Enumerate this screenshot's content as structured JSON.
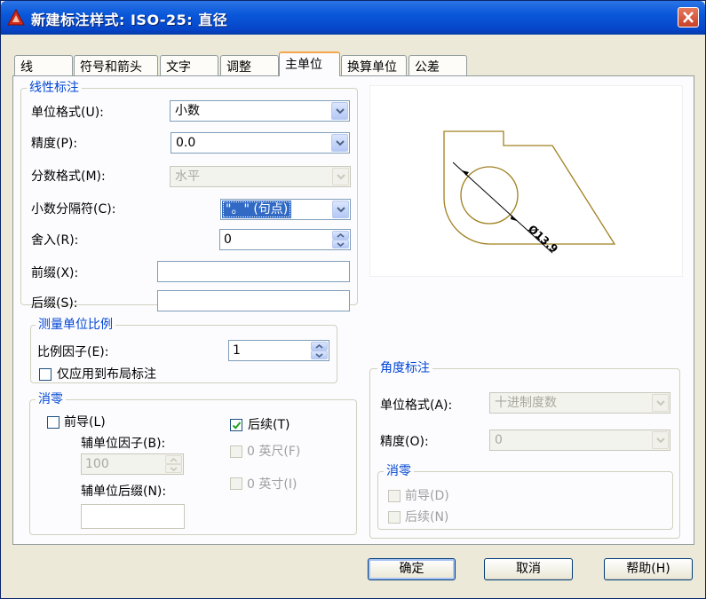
{
  "window": {
    "title": "新建标注样式: ISO-25: 直径",
    "title_icon": "autocad-icon",
    "close": "close-icon"
  },
  "tabs": [
    {
      "label": "线",
      "active": false
    },
    {
      "label": "符号和箭头",
      "active": false
    },
    {
      "label": "文字",
      "active": false
    },
    {
      "label": "调整",
      "active": false
    },
    {
      "label": "主单位",
      "active": true
    },
    {
      "label": "换算单位",
      "active": false
    },
    {
      "label": "公差",
      "active": false
    }
  ],
  "linear": {
    "title": "线性标注",
    "unit_format_label": "单位格式(U):",
    "unit_format_value": "小数",
    "precision_label": "精度(P):",
    "precision_value": "0.0",
    "fraction_format_label": "分数格式(M):",
    "fraction_format_value": "水平",
    "decimal_sep_label": "小数分隔符(C):",
    "decimal_sep_value": "\"。\" (句点)",
    "round_label": "舍入(R):",
    "round_value": "0",
    "prefix_label": "前缀(X):",
    "prefix_value": "",
    "suffix_label": "后缀(S):",
    "suffix_value": ""
  },
  "scale": {
    "title": "测量单位比例",
    "factor_label": "比例因子(E):",
    "factor_value": "1",
    "layout_only_label": "仅应用到布局标注",
    "layout_only_checked": false
  },
  "zero_linear": {
    "title": "消零",
    "leading_label": "前导(L)",
    "leading_checked": false,
    "trailing_label": "后续(T)",
    "trailing_checked": true,
    "sub_factor_label": "辅单位因子(B):",
    "sub_factor_value": "100",
    "sub_suffix_label": "辅单位后缀(N):",
    "sub_suffix_value": "",
    "feet_label": "0 英尺(F)",
    "inches_label": "0 英寸(I)"
  },
  "preview": {
    "dimension_text": "Ø13.9"
  },
  "angular": {
    "title": "角度标注",
    "unit_format_label": "单位格式(A):",
    "unit_format_value": "十进制度数",
    "precision_label": "精度(O):",
    "precision_value": "0",
    "zero_title": "消零",
    "leading_label": "前导(D)",
    "trailing_label": "后续(N)"
  },
  "buttons": {
    "ok": "确定",
    "cancel": "取消",
    "help": "帮助(H)"
  }
}
